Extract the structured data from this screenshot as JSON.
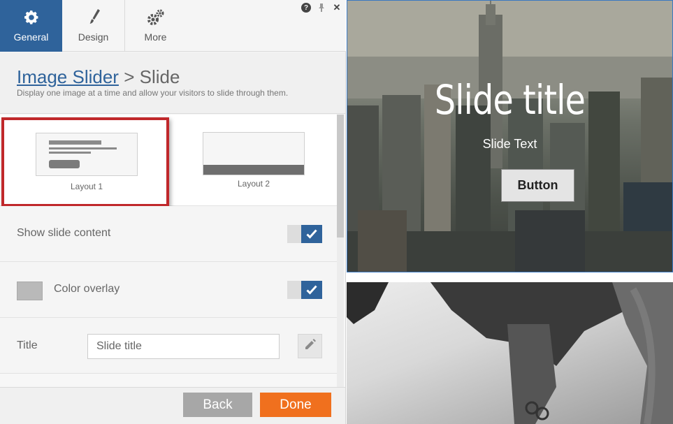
{
  "tabs": [
    {
      "label": "General",
      "icon": "gear-icon",
      "active": true
    },
    {
      "label": "Design",
      "icon": "brush-icon",
      "active": false
    },
    {
      "label": "More",
      "icon": "gears-icon",
      "active": false
    }
  ],
  "window_controls": {
    "help": "?",
    "pin": "pin-icon",
    "close": "✕"
  },
  "header": {
    "breadcrumb_link": "Image Slider",
    "breadcrumb_sep": " > ",
    "breadcrumb_current": "Slide",
    "subtitle": "Display one image at a time and allow your visitors to slide through them."
  },
  "layouts": [
    {
      "label": "Layout 1",
      "selected": true
    },
    {
      "label": "Layout 2",
      "selected": false
    }
  ],
  "settings": {
    "show_slide_content": {
      "label": "Show slide content",
      "checked": true
    },
    "color_overlay": {
      "label": "Color overlay",
      "checked": true,
      "color": "#b9b9b9"
    },
    "title": {
      "label": "Title",
      "value": "Slide title"
    }
  },
  "footer": {
    "back_label": "Back",
    "done_label": "Done"
  },
  "preview": {
    "slide_title": "Slide title",
    "slide_text": "Slide Text",
    "slide_button": "Button"
  },
  "colors": {
    "accent": "#2f639b",
    "done": "#f0701e",
    "back": "#a7a7a7",
    "highlight": "#c0282b"
  }
}
